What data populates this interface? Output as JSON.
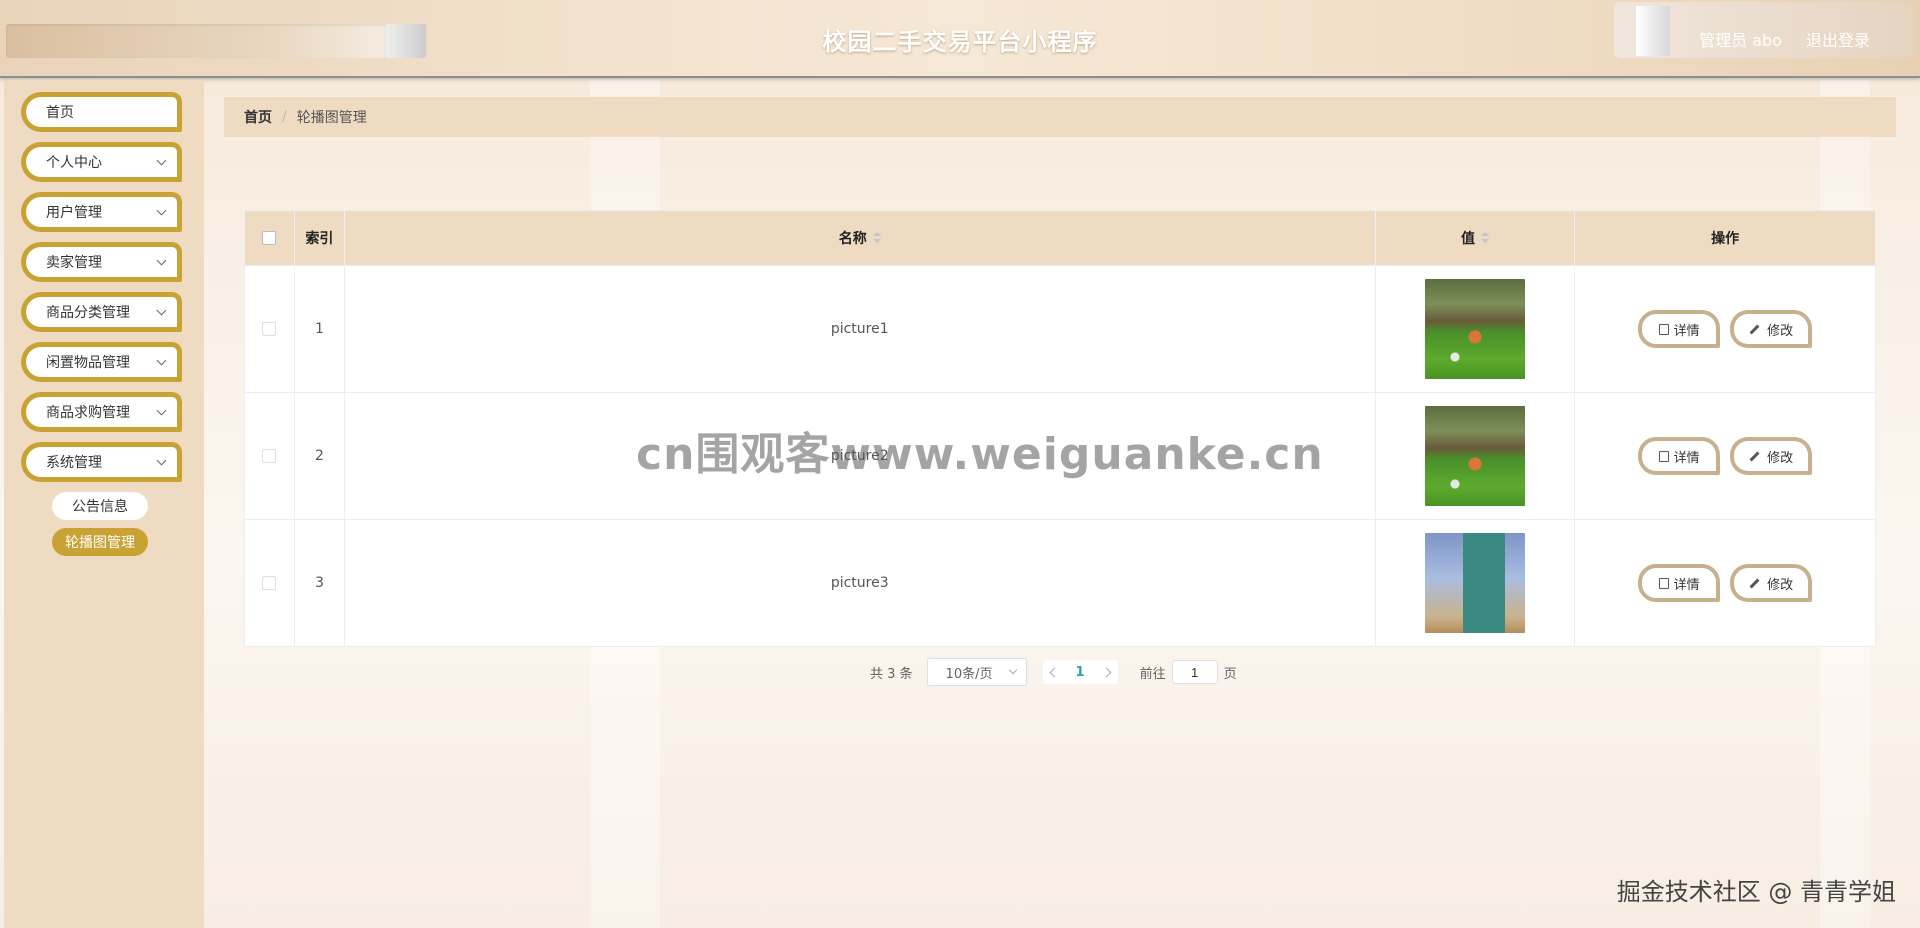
{
  "header": {
    "title": "校园二手交易平台小程序",
    "user": "管理员 abo",
    "logout": "退出登录"
  },
  "sidebar": {
    "items": [
      {
        "label": "首页",
        "has_children": false
      },
      {
        "label": "个人中心",
        "has_children": true
      },
      {
        "label": "用户管理",
        "has_children": true
      },
      {
        "label": "卖家管理",
        "has_children": true
      },
      {
        "label": "商品分类管理",
        "has_children": true
      },
      {
        "label": "闲置物品管理",
        "has_children": true
      },
      {
        "label": "商品求购管理",
        "has_children": true
      },
      {
        "label": "系统管理",
        "has_children": true
      }
    ],
    "sub_items": [
      {
        "label": "公告信息",
        "active": false
      },
      {
        "label": "轮播图管理",
        "active": true
      }
    ]
  },
  "breadcrumb": {
    "home": "首页",
    "separator": "/",
    "current": "轮播图管理"
  },
  "table": {
    "columns": [
      "",
      "索引",
      "名称",
      "值",
      "操作"
    ],
    "rows": [
      {
        "index": "1",
        "name": "picture1",
        "image": "garden"
      },
      {
        "index": "2",
        "name": "picture2",
        "image": "garden"
      },
      {
        "index": "3",
        "name": "picture3",
        "image": "room"
      }
    ],
    "actions": {
      "detail": "详情",
      "edit": "修改"
    }
  },
  "pagination": {
    "total": "共 3 条",
    "page_size": "10条/页",
    "current_page": "1",
    "goto_label": "前往",
    "goto_value": "1",
    "page_suffix": "页"
  },
  "watermarks": {
    "center": "cn围观客www.weiguanke.cn",
    "corner": "掘金技术社区 @ 青青学姐"
  },
  "colors": {
    "accent": "#c9a234",
    "sidebar_bg": "#eedbc1",
    "page_active": "#23a7a0"
  }
}
